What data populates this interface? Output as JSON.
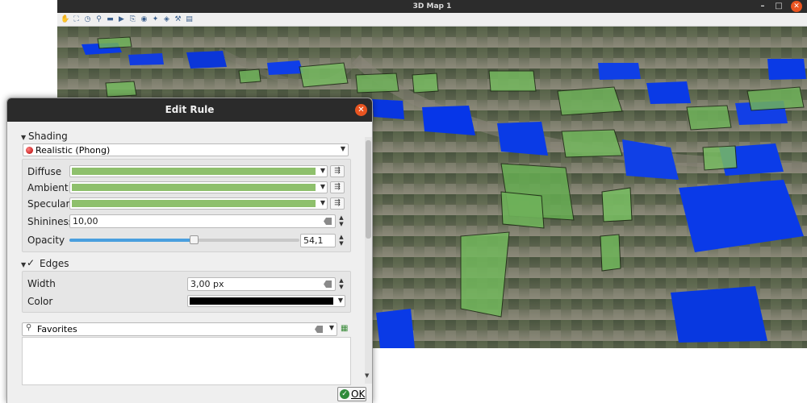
{
  "map_window": {
    "title": "3D Map 1",
    "controls": {
      "minimize": "–",
      "maximize": "□",
      "close": "✕"
    },
    "toolbar_icons": [
      "pan-icon",
      "zoom-full-icon",
      "identify-icon",
      "measure-icon",
      "animation-icon",
      "play-icon",
      "export-icon",
      "camera-icon",
      "settings-icon",
      "layers-icon",
      "tools-icon",
      "options-icon"
    ]
  },
  "dialog": {
    "title": "Edit Rule",
    "close": "✕",
    "shading": {
      "section_label": "Shading",
      "model": "Realistic (Phong)",
      "diffuse_label": "Diffuse",
      "ambient_label": "Ambient",
      "specular_label": "Specular",
      "diffuse_color": "#8ec06c",
      "ambient_color": "#8ec06c",
      "specular_color": "#8ec06c",
      "shininess_label": "Shininess",
      "shininess_value": "10,00",
      "opacity_label": "Opacity",
      "opacity_value": "54,1",
      "opacity_fraction": 0.541
    },
    "edges": {
      "section_label": "Edges",
      "checked": "✓",
      "width_label": "Width",
      "width_value": "3,00 px",
      "color_label": "Color",
      "color": "#000000"
    },
    "favorites": {
      "value": "Favorites"
    },
    "ok_label": "OK",
    "accent": "#4a9fde",
    "slider_fill": "#4a9fde"
  }
}
